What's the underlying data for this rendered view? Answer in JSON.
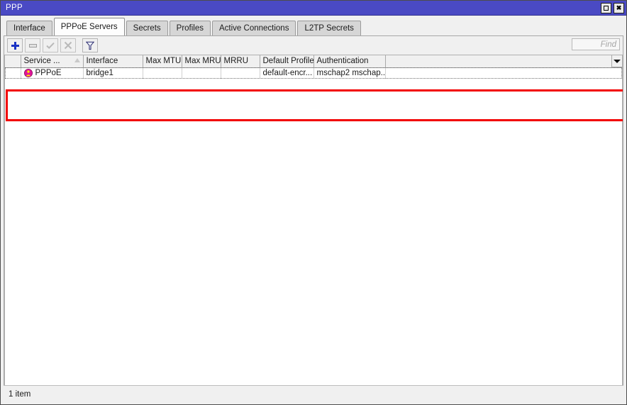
{
  "window": {
    "title": "PPP",
    "titlebar_color": "#4a4ac4",
    "buttons": {
      "restore_label": "",
      "restore_icon": "restore-icon",
      "close_label": "✖",
      "close_icon": "close-icon"
    }
  },
  "tabs": [
    {
      "label": "Interface",
      "active": false
    },
    {
      "label": "PPPoE Servers",
      "active": true
    },
    {
      "label": "Secrets",
      "active": false
    },
    {
      "label": "Profiles",
      "active": false
    },
    {
      "label": "Active Connections",
      "active": false
    },
    {
      "label": "L2TP Secrets",
      "active": false
    }
  ],
  "toolbar": {
    "buttons": [
      {
        "icon": "plus-icon",
        "name": "add-button",
        "enabled": true
      },
      {
        "icon": "minus-icon",
        "name": "remove-button",
        "enabled": false
      },
      {
        "icon": "check-icon",
        "name": "enable-button",
        "enabled": false
      },
      {
        "icon": "cross-icon",
        "name": "disable-button",
        "enabled": false
      },
      {
        "icon": "funnel-icon",
        "name": "filter-button",
        "enabled": true
      }
    ],
    "find": {
      "value": "",
      "placeholder": "Find"
    }
  },
  "table": {
    "columns": [
      {
        "label": "",
        "key": "flag",
        "width": 22,
        "sorted": false
      },
      {
        "label": "Service ...",
        "key": "service",
        "width": 88,
        "sorted": true,
        "sort_dir": "asc"
      },
      {
        "label": "Interface",
        "key": "interface",
        "width": 84,
        "sorted": false
      },
      {
        "label": "Max MTU",
        "key": "max_mtu",
        "width": 55,
        "sorted": false
      },
      {
        "label": "Max MRU",
        "key": "max_mru",
        "width": 55,
        "sorted": false
      },
      {
        "label": "MRRU",
        "key": "mrru",
        "width": 55,
        "sorted": false
      },
      {
        "label": "Default Profile",
        "key": "default_profile",
        "width": 76,
        "sorted": false
      },
      {
        "label": "Authentication",
        "key": "authentication",
        "width": 101,
        "sorted": false
      },
      {
        "label": "",
        "key": "spacer",
        "width": 0,
        "sorted": false
      }
    ],
    "rows": [
      {
        "flag": "",
        "status_icon": "pppoe-service-icon",
        "service": "PPPoE",
        "interface": "bridge1",
        "max_mtu": "",
        "max_mru": "",
        "mrru": "",
        "default_profile": "default-encr...",
        "authentication": "mschap2 mschap...",
        "spacer": ""
      }
    ],
    "column_menu_icon": "chevron-down-icon"
  },
  "annotation": {
    "highlight_color": "#f20000"
  },
  "statusbar": {
    "count_text": "1 item"
  }
}
